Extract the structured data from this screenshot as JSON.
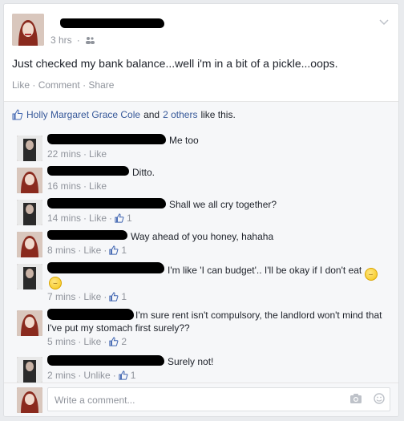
{
  "post": {
    "time": "3 hrs",
    "privacy_icon": "friends-icon",
    "text": "Just checked my bank balance...well i'm in a bit of a pickle...oops.",
    "actions": [
      "Like",
      "Comment",
      "Share"
    ]
  },
  "likes": {
    "names": "Holly Margaret Grace Cole",
    "and": "and",
    "others": "2 others",
    "suffix": "like this."
  },
  "comments": [
    {
      "text": "Me too",
      "time": "22 mins",
      "action": "Like",
      "like_count": ""
    },
    {
      "text": "Ditto.",
      "time": "16 mins",
      "action": "Like",
      "like_count": ""
    },
    {
      "text": "Shall we all cry together?",
      "time": "14 mins",
      "action": "Like",
      "like_count": "1"
    },
    {
      "text": "Way ahead of you honey, hahaha",
      "time": "8 mins",
      "action": "Like",
      "like_count": "1"
    },
    {
      "text": "I'm like 'I can budget'.. I'll be okay if I don't eat",
      "time": "7 mins",
      "action": "Like",
      "like_count": "1"
    },
    {
      "text": "I'm sure rent isn't compulsory, the landlord won't mind that I've put my stomach first surely??",
      "time": "5 mins",
      "action": "Like",
      "like_count": "2"
    },
    {
      "text": "Surely not!",
      "time": "2 mins",
      "action": "Unlike",
      "like_count": "1"
    }
  ],
  "composer": {
    "placeholder": "Write a comment..."
  },
  "colors": {
    "link": "#365899",
    "meta": "#90949c",
    "background": "#e9ebee"
  }
}
